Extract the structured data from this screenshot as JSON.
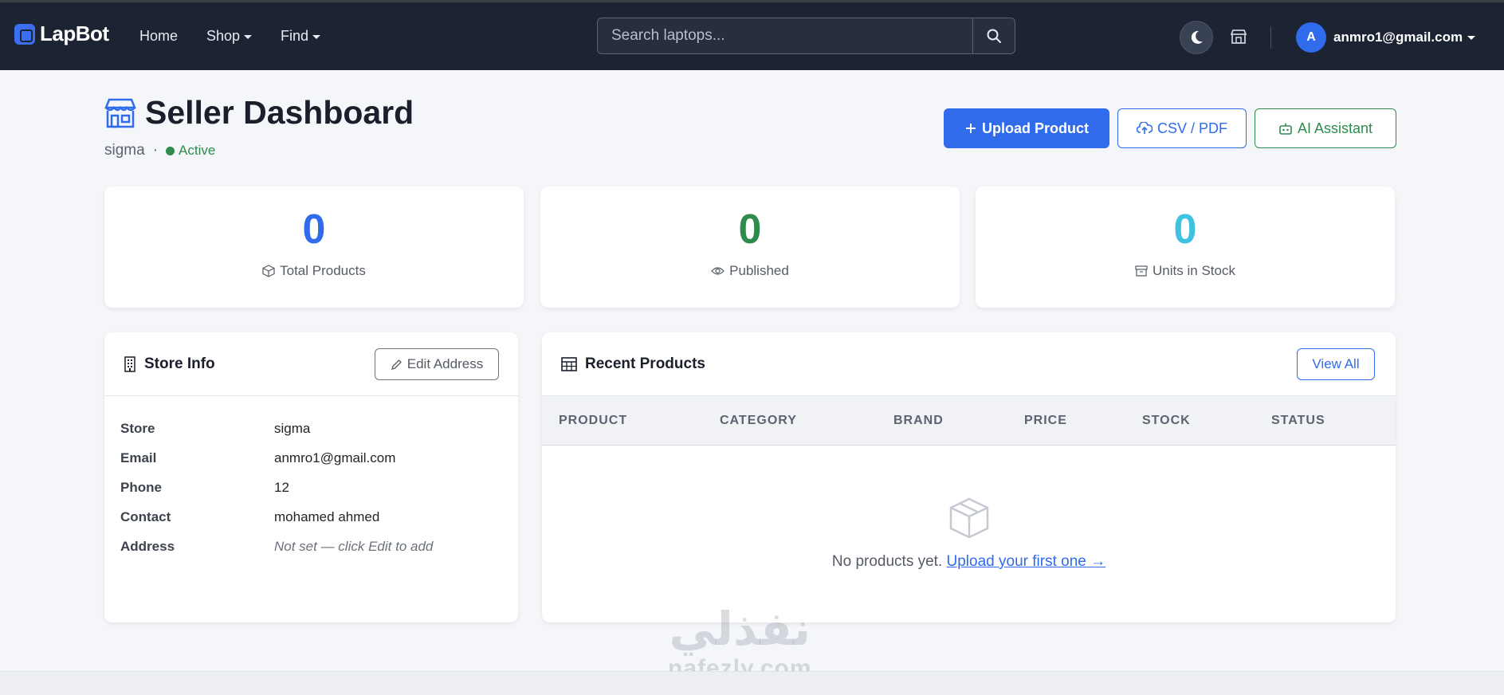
{
  "nav": {
    "brand": "LapBot",
    "links": [
      {
        "label": "Home"
      },
      {
        "label": "Shop"
      },
      {
        "label": "Find"
      }
    ],
    "search_placeholder": "Search laptops...",
    "user_initial": "A",
    "user_email": "anmro1@gmail.com"
  },
  "header": {
    "title": "Seller Dashboard",
    "store_name": "sigma",
    "separator": "·",
    "status": "Active",
    "buttons": {
      "upload": "Upload Product",
      "csv": "CSV / PDF",
      "ai": "AI Assistant"
    }
  },
  "stats": [
    {
      "value": "0",
      "label": "Total Products",
      "color": "#2f6bea"
    },
    {
      "value": "0",
      "label": "Published",
      "color": "#2e8b4e"
    },
    {
      "value": "0",
      "label": "Units in Stock",
      "color": "#3fc1e0"
    }
  ],
  "store_info": {
    "title": "Store Info",
    "edit_label": "Edit Address",
    "rows": [
      {
        "key": "Store",
        "value": "sigma"
      },
      {
        "key": "Email",
        "value": "anmro1@gmail.com"
      },
      {
        "key": "Phone",
        "value": "12"
      },
      {
        "key": "Contact",
        "value": "mohamed ahmed"
      },
      {
        "key": "Address",
        "value": "Not set — click Edit to add"
      }
    ]
  },
  "recent_products": {
    "title": "Recent Products",
    "view_all": "View All",
    "columns": [
      "PRODUCT",
      "CATEGORY",
      "BRAND",
      "PRICE",
      "STOCK",
      "STATUS"
    ],
    "empty_text": "No products yet.",
    "empty_link": "Upload your first one →"
  },
  "watermark": {
    "arabic": "نفذلي",
    "latin": "nafezly.com"
  },
  "colors": {
    "navbar": "#1c2333",
    "primary": "#2f6bea",
    "success": "#2e8b4e",
    "info": "#3fc1e0"
  }
}
